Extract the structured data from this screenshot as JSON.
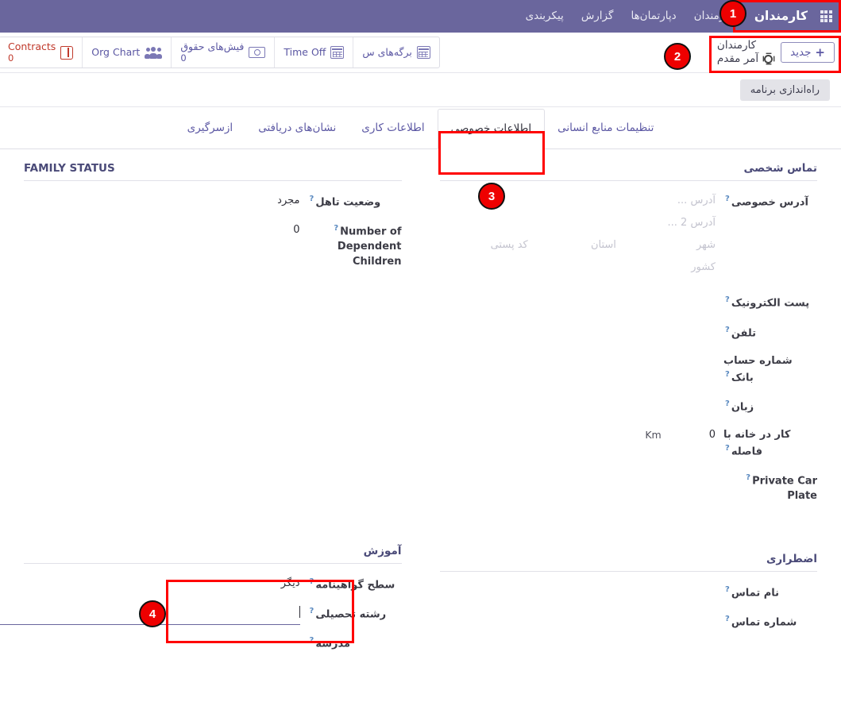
{
  "topbar": {
    "apps_icon": "apps-grid-icon",
    "app_name": "کارمندان",
    "menu": [
      {
        "label": "کارمندان"
      },
      {
        "label": "دپارتمان‌ها"
      },
      {
        "label": "گزارش"
      },
      {
        "label": "پیکربندی"
      }
    ]
  },
  "controlpanel": {
    "new_button": "جدید",
    "new_plus": "+",
    "breadcrumb_root": "کارمندان",
    "breadcrumb_current": "آمر مقدم",
    "gear_icon": "gear-icon",
    "stats": [
      {
        "label": "Contracts",
        "count": "0",
        "icon": "book-icon",
        "color": "#c0392b"
      },
      {
        "label": "Org Chart",
        "count": "",
        "icon": "people-icon",
        "color": "#5b57a3"
      },
      {
        "label": "فیش‌های حقوق",
        "count": "0",
        "icon": "money-icon",
        "color": "#5b57a3"
      },
      {
        "label": "Time Off",
        "count": "",
        "icon": "calendar-icon",
        "color": "#5b57a3"
      },
      {
        "label": "برگه‌های س",
        "count": "",
        "icon": "calendar-icon",
        "color": "#5b57a3"
      }
    ]
  },
  "ribbon": {
    "launch_button": "راه‌اندازی برنامه"
  },
  "tabs": [
    {
      "label": "ازسرگیری",
      "active": false
    },
    {
      "label": "نشان‌های دریافتی",
      "active": false
    },
    {
      "label": "اطلاعات کاری",
      "active": false
    },
    {
      "label": "اطلاعات خصوصی",
      "active": true
    },
    {
      "label": "تنظیمات منابع انسانی",
      "active": false
    }
  ],
  "right_column": {
    "contact_group": {
      "title": "تماس شخصی",
      "address_label": "آدرس خصوصی",
      "address_placeholders": {
        "street": "آدرس ...",
        "street2": "آدرس 2 ...",
        "city": "شهر",
        "state": "استان",
        "zip": "کد پستی",
        "country": "کشور"
      },
      "fields": [
        {
          "label": "پست الکترونیک",
          "value": ""
        },
        {
          "label": "تلفن",
          "value": ""
        },
        {
          "label": "شماره حساب بانک",
          "value": ""
        },
        {
          "label": "زبان",
          "value": ""
        },
        {
          "label": "کار در خانه با فاصله",
          "value": "0",
          "unit": "Km"
        },
        {
          "label": "Private Car Plate",
          "value": "",
          "ltr": true
        }
      ]
    },
    "emergency_group": {
      "title": "اضطراری",
      "fields": [
        {
          "label": "نام تماس",
          "value": ""
        },
        {
          "label": "شماره تماس",
          "value": ""
        }
      ]
    }
  },
  "left_column": {
    "family_group": {
      "title": "FAMILY STATUS",
      "fields": [
        {
          "label": "وضعیت تاهل",
          "value": "مجرد"
        },
        {
          "label": "Number of Dependent Children",
          "value": "0",
          "ltr": true
        }
      ]
    },
    "education_group": {
      "title": "آموزش",
      "fields": [
        {
          "label": "سطح گواهینامه",
          "value": "دیگر"
        },
        {
          "label": "رشته تحصیلی",
          "value": "",
          "focused": true
        },
        {
          "label": "مدرسه",
          "value": ""
        }
      ]
    }
  },
  "annotations": [
    {
      "num": "1"
    },
    {
      "num": "2"
    },
    {
      "num": "3"
    },
    {
      "num": "4"
    }
  ],
  "colors": {
    "header_purple": "#6a669d",
    "accent_purple": "#5b57a3",
    "annotation_red": "#ee0000",
    "danger_red": "#c0392b",
    "help_blue": "#5b8ac0"
  }
}
